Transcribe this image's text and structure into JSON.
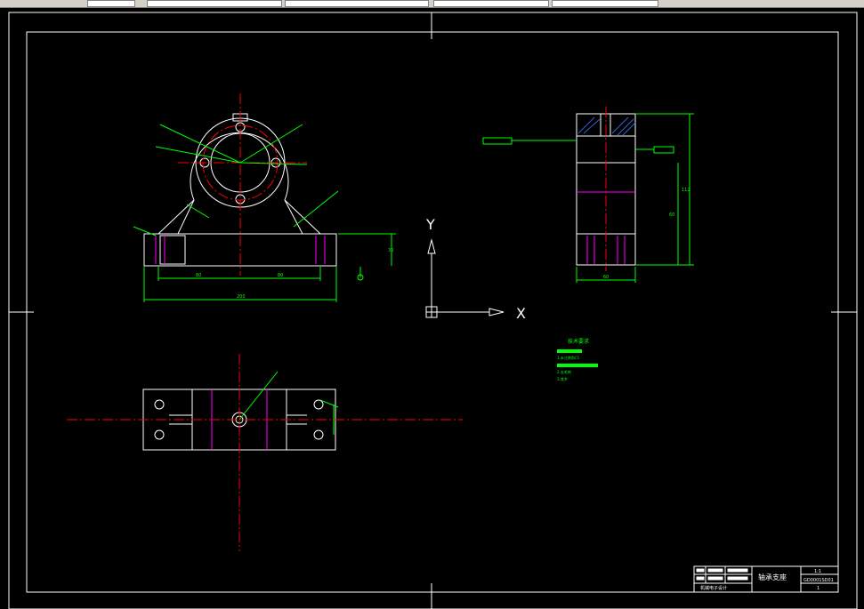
{
  "toolbar": {
    "items": [
      {
        "name": "layer-dropdown"
      },
      {
        "name": "color-dropdown"
      },
      {
        "name": "linetype-dropdown"
      },
      {
        "name": "lineweight-dropdown"
      },
      {
        "name": "plotstyle-dropdown"
      }
    ]
  },
  "colors": {
    "background": "#000000",
    "outline": "#ffffff",
    "dimension": "#00ff00",
    "center": "#ff0000",
    "hidden": "#ff00ff",
    "hatch": "#3a5fcd"
  },
  "drawing": {
    "ucs": {
      "x_label": "X",
      "y_label": "Y"
    },
    "title_block": {
      "part_name": "轴承支座",
      "scale": "1:1",
      "drawing_no": "GD0001SD01",
      "company": "机械电子设计",
      "sheet": "1"
    },
    "tech_requirements": {
      "title": "技术要求",
      "items": [
        "1.未注倒角C1",
        "2.去毛刺",
        "3.其余"
      ]
    },
    "dims": {
      "front_width": "200",
      "front_half_left": "80",
      "front_half_right": "80",
      "front_base_h": "30",
      "side_height": "112",
      "side_upper": "60",
      "side_width": "60"
    }
  }
}
